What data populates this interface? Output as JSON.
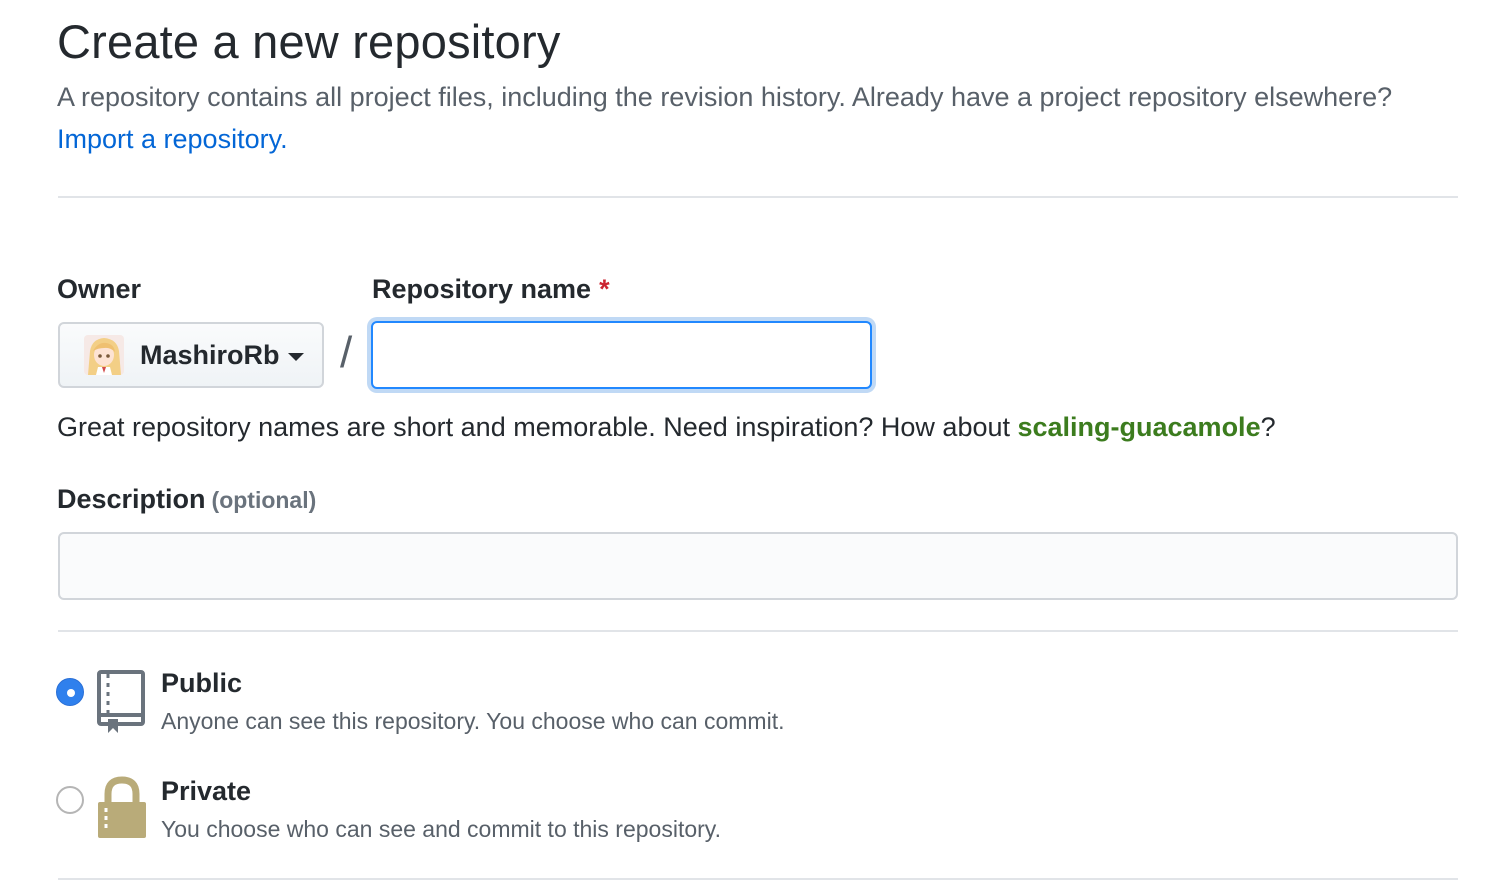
{
  "header": {
    "title": "Create a new repository",
    "subtitle": "A repository contains all project files, including the revision history. Already have a project repository elsewhere?",
    "import_link": "Import a repository."
  },
  "owner": {
    "label": "Owner",
    "selected": "MashiroRb",
    "avatar_icon": "avatar-image"
  },
  "separator": "/",
  "repo_name": {
    "label": "Repository name",
    "required_mark": "*",
    "value": "",
    "placeholder": ""
  },
  "hint": {
    "prefix": "Great repository names are short and memorable. Need inspiration? How about ",
    "suggestion": "scaling-guacamole",
    "suffix": "?"
  },
  "description": {
    "label": "Description",
    "optional_label": "(optional)",
    "value": "",
    "placeholder": ""
  },
  "visibility": {
    "options": [
      {
        "title": "Public",
        "description": "Anyone can see this repository. You choose who can commit.",
        "selected": true,
        "icon": "repo-book-icon"
      },
      {
        "title": "Private",
        "description": "You choose who can see and commit to this repository.",
        "selected": false,
        "icon": "lock-icon"
      }
    ]
  },
  "colors": {
    "link": "#0366d6",
    "required": "#cb2431",
    "suggestion": "#3c7c1e",
    "focus_border": "#2188ff",
    "radio_selected": "#2f80ed",
    "lock_icon": "#b9ab79"
  }
}
